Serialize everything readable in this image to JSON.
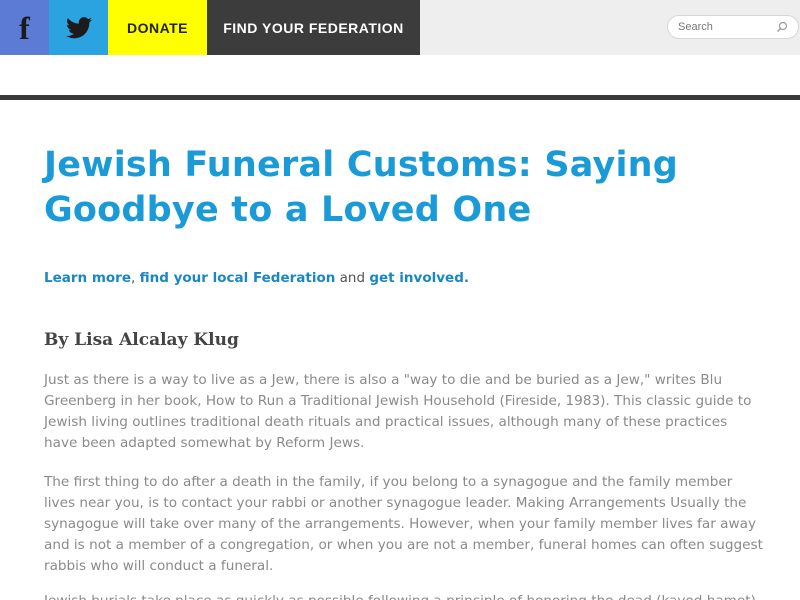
{
  "topbar": {
    "facebook_icon": "facebook-icon",
    "facebook_glyph": "f",
    "twitter_icon": "twitter-icon",
    "donate_label": "DONATE",
    "find_federation_label": "FIND YOUR FEDERATION",
    "search_placeholder": "Search",
    "search_icon": "search-icon",
    "colors": {
      "facebook": "#5b7bd5",
      "twitter": "#2aa3e0",
      "donate": "#ffff00",
      "find_federation": "#3c3c3c"
    }
  },
  "article": {
    "title": "Jewish Funeral Customs: Saying Goodbye to a Loved One",
    "cta": {
      "learn_more": "Learn more",
      "sep": ", ",
      "find_local": "find your local Federation",
      "and": " and ",
      "get_involved": "get involved."
    },
    "byline": "By Lisa Alcalay Klug",
    "paragraphs": [
      "Just as there is a way to live as a Jew, there is also a \"way to die and be buried as a Jew,\" writes Blu Greenberg in her book, How to Run a Traditional Jewish Household (Fireside, 1983). This classic guide to Jewish living outlines traditional death rituals and practical issues, although many of these practices have been adapted somewhat by Reform Jews.",
      "The first thing to do after a death in the family, if you belong to a synagogue and the family member lives near you, is to contact your rabbi or another synagogue leader. Making Arrangements Usually the synagogue will take over many of the arrangements. However, when your family member lives far away and is not a member of a congregation, or when you are not a member, funeral homes can often suggest rabbis who will conduct a funeral.",
      "Jewish burials take place as quickly as possible following a principle of honoring the dead (kavod hamet)."
    ],
    "colors": {
      "title": "#1a9bd7",
      "link": "#1a87c4",
      "body_text": "#8a8a8a"
    }
  }
}
